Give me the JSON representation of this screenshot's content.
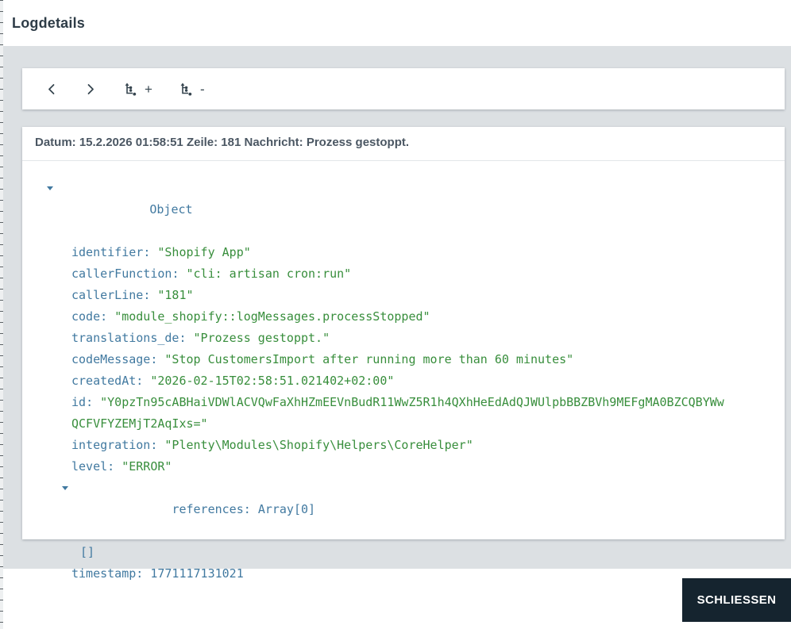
{
  "colors": {
    "key": "#4179a0",
    "string_value": "#388e3c",
    "icon": "#36454f",
    "title_text": "#2e3c47",
    "summary_text": "#4b5763",
    "close_button_bg": "#15242f",
    "body_background": "#dce0e3"
  },
  "dialog": {
    "title": "Logdetails"
  },
  "toolbar": {
    "prev_icon": "chevron-left",
    "next_icon": "chevron-right",
    "expand_icon": "expand-tree",
    "expand_label": "+",
    "collapse_icon": "collapse-tree",
    "collapse_label": "-"
  },
  "summary": {
    "text": "Datum: 15.2.2026 01:58:51 Zeile: 181 Nachricht: Prozess gestoppt."
  },
  "tree": {
    "root_label": "Object",
    "entries": [
      {
        "key": "identifier",
        "value": "\"Shopify App\"",
        "type": "string"
      },
      {
        "key": "callerFunction",
        "value": "\"cli: artisan cron:run\"",
        "type": "string"
      },
      {
        "key": "callerLine",
        "value": "\"181\"",
        "type": "string"
      },
      {
        "key": "code",
        "value": "\"module_shopify::logMessages.processStopped\"",
        "type": "string"
      },
      {
        "key": "translations_de",
        "value": "\"Prozess gestoppt.\"",
        "type": "string"
      },
      {
        "key": "codeMessage",
        "value": "\"Stop CustomersImport after running more than 60 minutes\"",
        "type": "string"
      },
      {
        "key": "createdAt",
        "value": "\"2026-02-15T02:58:51.021402+02:00\"",
        "type": "string"
      },
      {
        "key": "id",
        "value": "\"Y0pzTn95cABHaiVDWlACVQwFaXhHZmEEVnBudR11WwZ5R1h4QXhHeEdAdQJWUlpbBBZBVh9MEFgMA0BZCQBYWwQCFVFYZEMjT2AqIxs=\"",
        "type": "string"
      },
      {
        "key": "integration",
        "value": "\"Plenty\\Modules\\Shopify\\Helpers\\CoreHelper\"",
        "type": "string"
      },
      {
        "key": "level",
        "value": "\"ERROR\"",
        "type": "string"
      }
    ],
    "references": {
      "key": "references",
      "value": "Array[0]",
      "empty": "[]"
    },
    "timestamp": {
      "key": "timestamp",
      "value": "1771117131021"
    }
  },
  "footer": {
    "close_label": "SCHLIESSEN"
  }
}
